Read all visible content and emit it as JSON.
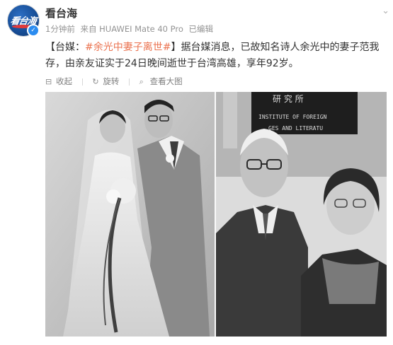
{
  "post": {
    "author": "看台海",
    "avatar_text": "看台海",
    "time": "1分钟前",
    "source": "来自 HUAWEI Mate 40 Pro",
    "edited": "已编辑",
    "text_prefix": "【台媒：",
    "topic": "#余光中妻子离世#",
    "text_rest": "】据台媒消息，已故知名诗人余光中的妻子范我存，由亲友证实于24日晚间逝世于台湾高雄，享年92岁。"
  },
  "actions": [
    {
      "icon": "star-icon",
      "label": "收起"
    },
    {
      "icon": "zoom-icon",
      "label": "旋转"
    },
    {
      "icon": "rotate-icon",
      "label": "查看大图"
    }
  ],
  "photos": [
    {
      "name": "wedding-photo"
    },
    {
      "name": "elderly-couple-photo",
      "sign_text": [
        "研 究 所",
        "INSTITUTE OF FOREIGN",
        "GES AND LITERATU"
      ]
    }
  ],
  "colors": {
    "topic": "#eb7350",
    "text": "#333333",
    "meta": "#939393",
    "verified": "#2b8cf0"
  }
}
